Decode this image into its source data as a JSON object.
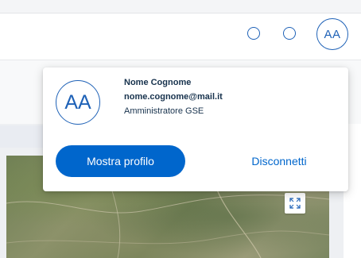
{
  "header": {
    "avatar_initials": "AA",
    "icons": [
      "circle-icon",
      "circle-icon"
    ]
  },
  "user_menu": {
    "avatar_initials": "AA",
    "name": "Nome Cognome",
    "email": "nome.cognome@mail.it",
    "role": "Amministratore GSE",
    "show_profile_label": "Mostra profilo",
    "logout_label": "Disconnetti"
  },
  "map": {
    "expand_icon": "expand-icon"
  },
  "colors": {
    "primary": "#0066cc",
    "accent_border": "#1f62b7",
    "text_dark": "#17324d"
  }
}
